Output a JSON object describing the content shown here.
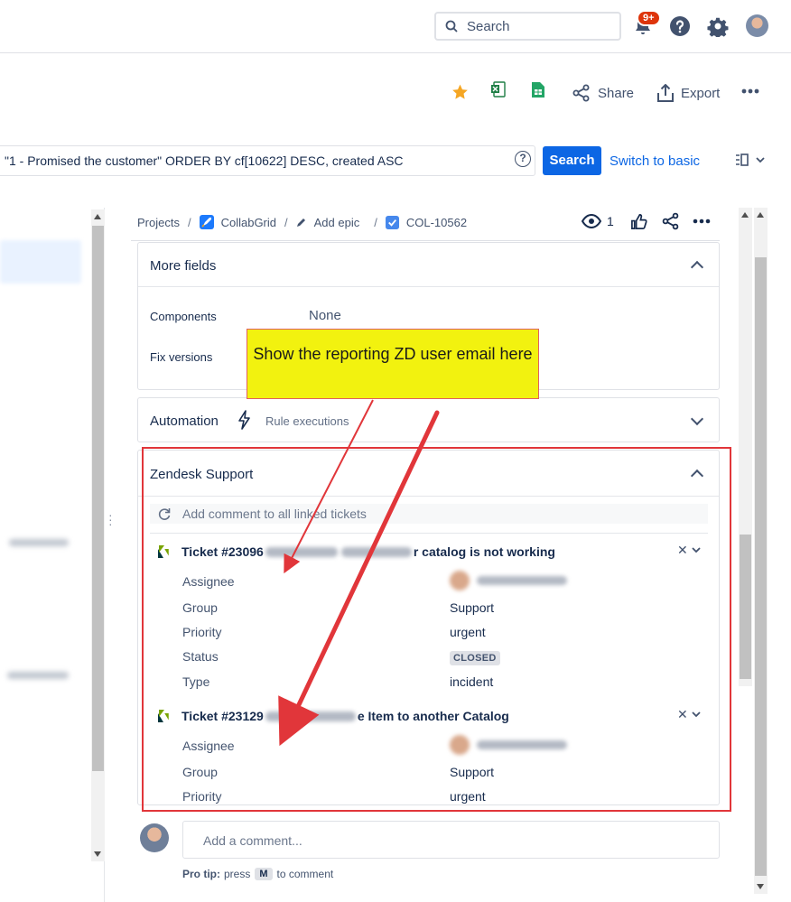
{
  "topbar": {
    "search_placeholder": "Search",
    "notification_count": "9+",
    "icons": [
      "search-icon",
      "bell-icon",
      "help-icon",
      "gear-icon",
      "avatar"
    ]
  },
  "toolbar": {
    "share_label": "Share",
    "export_label": "Export"
  },
  "jql": {
    "query": "\"1 - Promised the customer\" ORDER BY cf[10622] DESC, created ASC",
    "search_button": "Search",
    "switch_label": "Switch to basic",
    "help": "?"
  },
  "breadcrumb": {
    "projects": "Projects",
    "project": "CollabGrid",
    "epic": "Add epic",
    "issue": "COL-10562",
    "watchers": "1"
  },
  "more_fields": {
    "title": "More fields",
    "components_label": "Components",
    "components_value": "None",
    "fix_versions_label": "Fix versions"
  },
  "automation": {
    "title": "Automation",
    "rule_label": "Rule executions"
  },
  "zendesk": {
    "title": "Zendesk Support",
    "comment_placeholder": "Add comment to all linked tickets",
    "tickets": [
      {
        "title_start": "Ticket #23096",
        "title_end": "r catalog is not working",
        "labels": {
          "assignee": "Assignee",
          "group": "Group",
          "priority": "Priority",
          "status": "Status",
          "type": "Type"
        },
        "group": "Support",
        "priority": "urgent",
        "status": "CLOSED",
        "type": "incident"
      },
      {
        "title_start": "Ticket #23129",
        "title_end": "e Item to another Catalog",
        "labels": {
          "assignee": "Assignee",
          "group": "Group",
          "priority": "Priority"
        },
        "group": "Support",
        "priority": "urgent"
      }
    ],
    "remove_glyph": "✕"
  },
  "callout": {
    "text": "Show the reporting ZD user email here"
  },
  "comment": {
    "placeholder": "Add a comment...",
    "protip_label": "Pro tip:",
    "protip_press": "press",
    "protip_key": "M",
    "protip_end": "to comment"
  },
  "colors": {
    "primary": "#0c66e4",
    "annotation_red": "#e1363a",
    "callout_yellow": "#f2f20f",
    "badge_red": "#de350b"
  }
}
